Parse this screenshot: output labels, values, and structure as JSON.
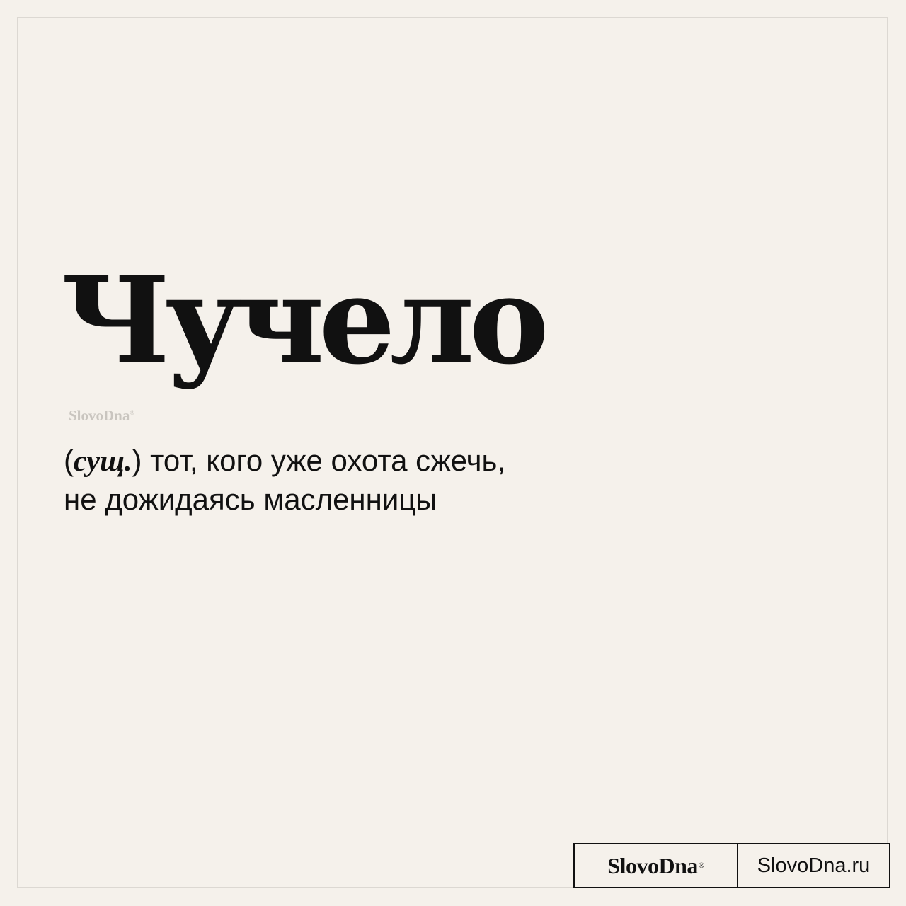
{
  "entry": {
    "word": "Чучело",
    "part_of_speech": "сущ.",
    "open_paren": "(",
    "close_paren": ")",
    "definition_line1": " тот, кого уже охота сжечь,",
    "definition_line2": "не дожидаясь масленницы"
  },
  "watermark": {
    "brand": "SlovoDna",
    "mark": "®"
  },
  "footer": {
    "brand": "SlovoDna",
    "mark": "®",
    "url": "SlovoDna.ru"
  },
  "colors": {
    "background": "#f5f1eb",
    "text": "#111111",
    "watermark": "#c9c5bf"
  }
}
